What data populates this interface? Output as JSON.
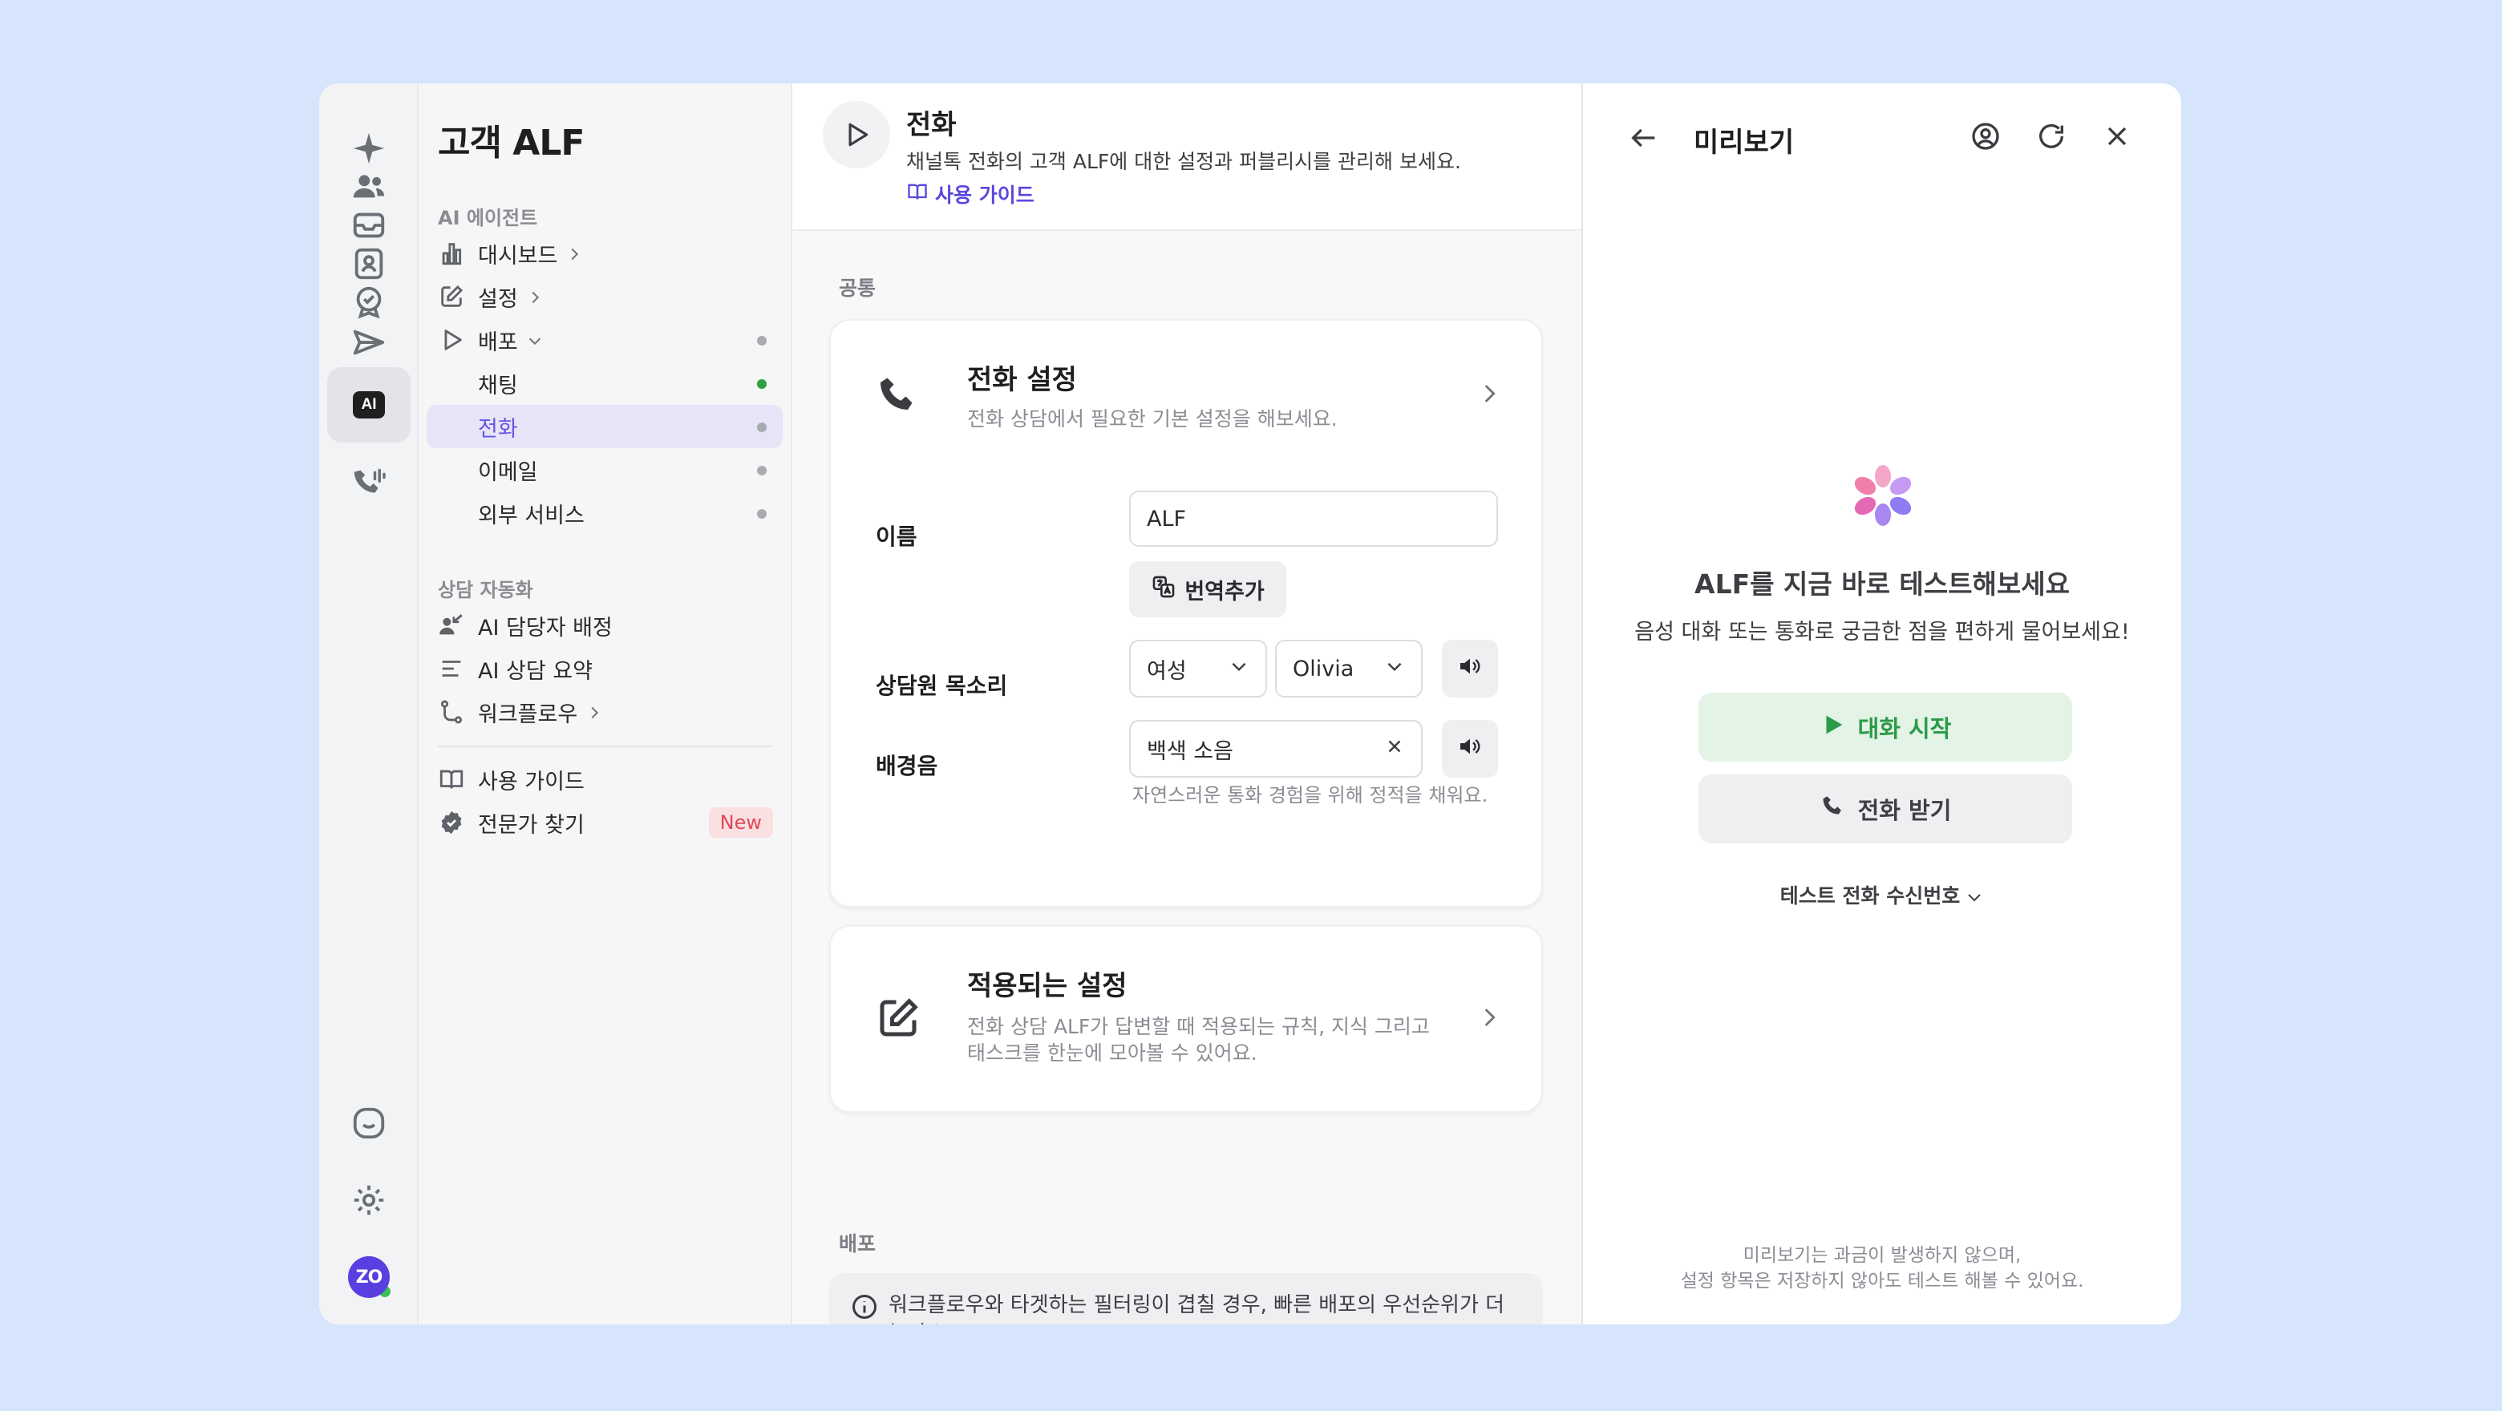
{
  "nav": {
    "title": "고객 ALF",
    "section_ai": "AI 에이전트",
    "dashboard": "대시보드",
    "settings": "설정",
    "deploy": "배포",
    "chat": "채팅",
    "phone": "전화",
    "email": "이메일",
    "external": "외부 서비스",
    "section_auto": "상담 자동화",
    "ai_assign": "AI 담당자 배정",
    "ai_summary": "AI 상담 요약",
    "workflow": "워크플로우",
    "guide": "사용 가이드",
    "expert": "전문가 찾기",
    "new_badge": "New"
  },
  "header": {
    "title": "전화",
    "description": "채널톡 전화의 고객 ALF에 대한 설정과 퍼블리시를 관리해 보세요.",
    "guide_link": "사용 가이드"
  },
  "common_section": "공통",
  "phone_settings": {
    "title": "전화 설정",
    "description": "전화 상담에서 필요한 기본 설정을 해보세요.",
    "name_label": "이름",
    "name_value": "ALF",
    "add_translation": "번역추가",
    "voice_label": "상담원 목소리",
    "gender_value": "여성",
    "voice_value": "Olivia",
    "bg_label": "배경음",
    "bg_value": "백색 소음",
    "bg_hint": "자연스러운 통화 경험을 위해 정적을 채워요."
  },
  "applied_settings": {
    "title": "적용되는 설정",
    "description": "전화 상담 ALF가 답변할 때 적용되는 규칙, 지식 그리고 태스크를 한눈에 모아볼 수 있어요."
  },
  "deploy_section": "배포",
  "deploy_info": "워크플로우와 타겟하는 필터링이 겹칠 경우, 빠른 배포의 우선순위가 더 높아요.",
  "preview": {
    "title": "미리보기",
    "headline": "ALF를 지금 바로 테스트해보세요",
    "subtext": "음성 대화 또는 통화로 궁금한 점을 편하게 물어보세요!",
    "start_button": "대화 시작",
    "call_button": "전화 받기",
    "test_number": "테스트 전화 수신번호",
    "footer_line1": "미리보기는 과금이 발생하지 않으며,",
    "footer_line2": "설정 항목은 저장하지 않아도 테스트 해볼 수 있어요."
  },
  "colors": {
    "accent": "#6a54e8",
    "active_nav_bg": "#e6e5f8",
    "green": "#2ea043",
    "start_bg": "#e3f3e6",
    "badge_bg": "#fbe0e2",
    "badge_text": "#e0485a",
    "zo_avatar": "#5a3fe0"
  },
  "icons": {
    "rail": [
      "sparkle-icon",
      "users-icon",
      "inbox-icon",
      "contact-icon",
      "badge-check-icon",
      "send-icon",
      "book-icon",
      "ai-icon",
      "phone-call-icon",
      "chat-bubble-icon",
      "gear-icon"
    ]
  }
}
